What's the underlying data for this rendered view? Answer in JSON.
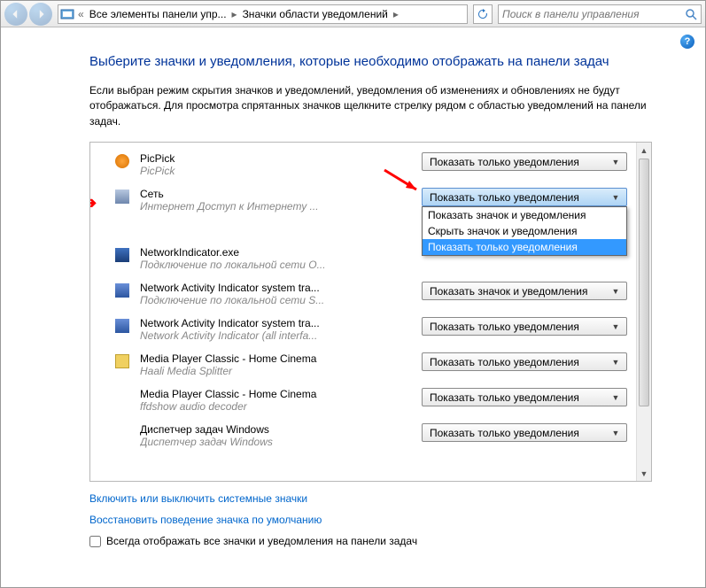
{
  "toolbar": {
    "breadcrumb": {
      "part1": "Все элементы панели упр...",
      "part2": "Значки области уведомлений"
    },
    "search_placeholder": "Поиск в панели управления"
  },
  "page": {
    "title": "Выберите значки и уведомления, которые необходимо отображать на панели задач",
    "description": "Если выбран режим скрытия значков и уведомлений, уведомления об изменениях и обновлениях не будут отображаться. Для просмотра спрятанных значков щелкните стрелку рядом с областью уведомлений на панели задач."
  },
  "options": {
    "show_notifications_only": "Показать только уведомления",
    "show_icon_and_notifications": "Показать значок и уведомления",
    "hide_icon_and_notifications": "Скрыть значок и уведомления"
  },
  "items": [
    {
      "name": "PicPick",
      "desc": "PicPick",
      "selected": "Показать только уведомления",
      "icon": "app-ico-picpick"
    },
    {
      "name": "Сеть",
      "desc": "Интернет Доступ к Интернету ...",
      "selected": "Показать только уведомления",
      "icon": "app-ico-net",
      "dropdown_open": true
    },
    {
      "name": "NetworkIndicator.exe",
      "desc": "Подключение по локальной сети O...",
      "selected": "",
      "icon": "app-ico-neti"
    },
    {
      "name": "Network Activity Indicator system tra...",
      "desc": "Подключение по локальной сети S...",
      "selected": "Показать значок и уведомления",
      "icon": "app-ico-act"
    },
    {
      "name": "Network Activity Indicator system tra...",
      "desc": "Network Activity Indicator (all interfa...",
      "selected": "Показать только уведомления",
      "icon": "app-ico-act"
    },
    {
      "name": "Media Player Classic - Home Cinema",
      "desc": "Haali Media Splitter",
      "selected": "Показать только уведомления",
      "icon": "app-ico-mpc"
    },
    {
      "name": "Media Player Classic - Home Cinema",
      "desc": "ffdshow audio decoder",
      "selected": "Показать только уведомления",
      "icon": "app-ico-blank"
    },
    {
      "name": "Диспетчер задач Windows",
      "desc": "Диспетчер задач Windows",
      "selected": "Показать только уведомления",
      "icon": "app-ico-blank"
    }
  ],
  "links": {
    "system_icons": "Включить или выключить системные значки",
    "restore_defaults": "Восстановить поведение значка по умолчанию"
  },
  "checkbox": {
    "label": "Всегда отображать все значки и уведомления на панели задач"
  }
}
